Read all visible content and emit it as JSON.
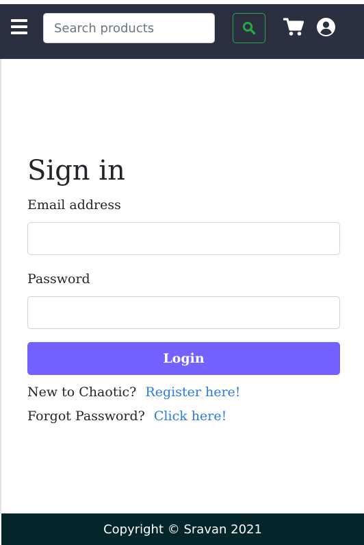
{
  "navbar": {
    "menu_icon": "hamburger-menu-icon",
    "search_placeholder": "Search products",
    "search_value": "",
    "search_button_icon": "search-icon",
    "cart_icon": "shopping-cart-icon",
    "account_icon": "user-circle-icon",
    "background_color": "#2b3040",
    "search_button_color": "#28a745"
  },
  "login_form": {
    "title": "Sign in",
    "email_label": "Email address",
    "email_value": "",
    "password_label": "Password",
    "password_value": "",
    "submit_label": "Login",
    "submit_color": "#7362ff",
    "register_prompt": "New to Chaotic?",
    "register_link": "Register here!",
    "forgot_prompt": "Forgot Password?",
    "forgot_link": "Click here!",
    "link_color": "#2a7ae4"
  },
  "footer": {
    "copyright": "Copyright © Sravan 2021",
    "background_color": "#04252a"
  }
}
